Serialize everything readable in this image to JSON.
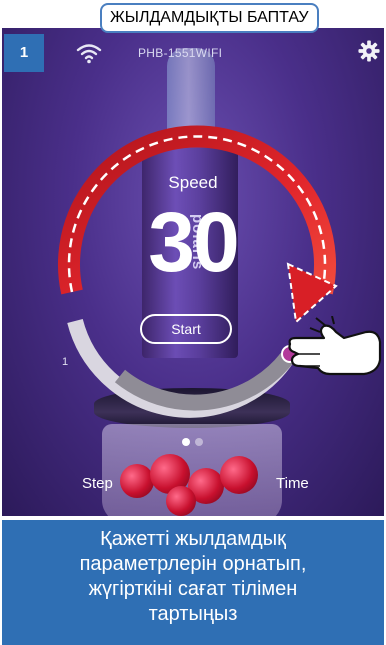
{
  "title": "ЖЫЛДАМДЫҚТЫ БАПТАУ",
  "step_number": "1",
  "device": {
    "name": "PHB-1551WIFI"
  },
  "brand": "polaris",
  "speed": {
    "label": "Speed",
    "value": "30",
    "min_label": "1"
  },
  "start_label": "Start",
  "tabs": {
    "step": "Step",
    "time": "Time"
  },
  "caption": {
    "line1": "Қажетті жылдамдық",
    "line2": "параметрлерін орнатып,",
    "line3": "жүгірткіні сағат тілімен",
    "line4": "тартыңыз"
  },
  "colors": {
    "accent_blue": "#2f6fb4",
    "arrow_red": "#d81f26",
    "background_purple": "#4a2f8a"
  },
  "icons": [
    "wifi-icon",
    "gear-icon",
    "hand-pointer-icon",
    "clockwise-arrow-icon"
  ]
}
